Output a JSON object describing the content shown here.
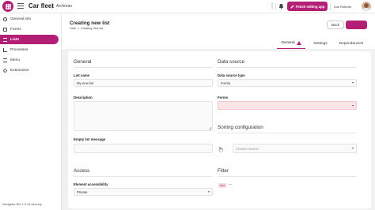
{
  "topbar": {
    "app_title": "Car fleet",
    "app_subtitle": "Archman",
    "more": "⋮",
    "finish_label": "Finish editing app",
    "user_name": "Zoe Roberts"
  },
  "sidebar": {
    "items": [
      {
        "label": "General info",
        "icon": "info-icon"
      },
      {
        "label": "Forms",
        "icon": "forms-icon"
      },
      {
        "label": "Lists",
        "icon": "lists-icon"
      },
      {
        "label": "Processes",
        "icon": "processes-icon"
      },
      {
        "label": "Menu",
        "icon": "menu-icon"
      },
      {
        "label": "Extensions",
        "icon": "extensions-icon"
      }
    ],
    "footer": "Navigator:360 1.3.13-develop"
  },
  "header": {
    "title": "Creating new list",
    "breadcrumb": [
      "Lists",
      ">",
      "Creating new list"
    ],
    "back_label": "Back"
  },
  "tabs": [
    {
      "label": "General",
      "warning": true
    },
    {
      "label": "Settings"
    },
    {
      "label": "Dependencies"
    }
  ],
  "general": {
    "title": "General",
    "list_name_label": "List name",
    "list_name_value": "My new list",
    "description_label": "Description",
    "description_value": "",
    "empty_message_label": "Empty list message",
    "empty_message_value": ""
  },
  "data_source": {
    "title": "Data source",
    "type_label": "Data source type",
    "type_value": "Forms",
    "forms_label": "Forms",
    "forms_value": ""
  },
  "sorting": {
    "title": "Sorting configuration",
    "placeholder": "Choose source"
  },
  "access": {
    "title": "Access",
    "accessibility_label": "Element accessibility",
    "accessibility_value": "Private"
  },
  "filter": {
    "title": "Filter",
    "chip": "And"
  },
  "colors": {
    "accent": "#b31f75",
    "error_bg": "#fbe5e8"
  }
}
